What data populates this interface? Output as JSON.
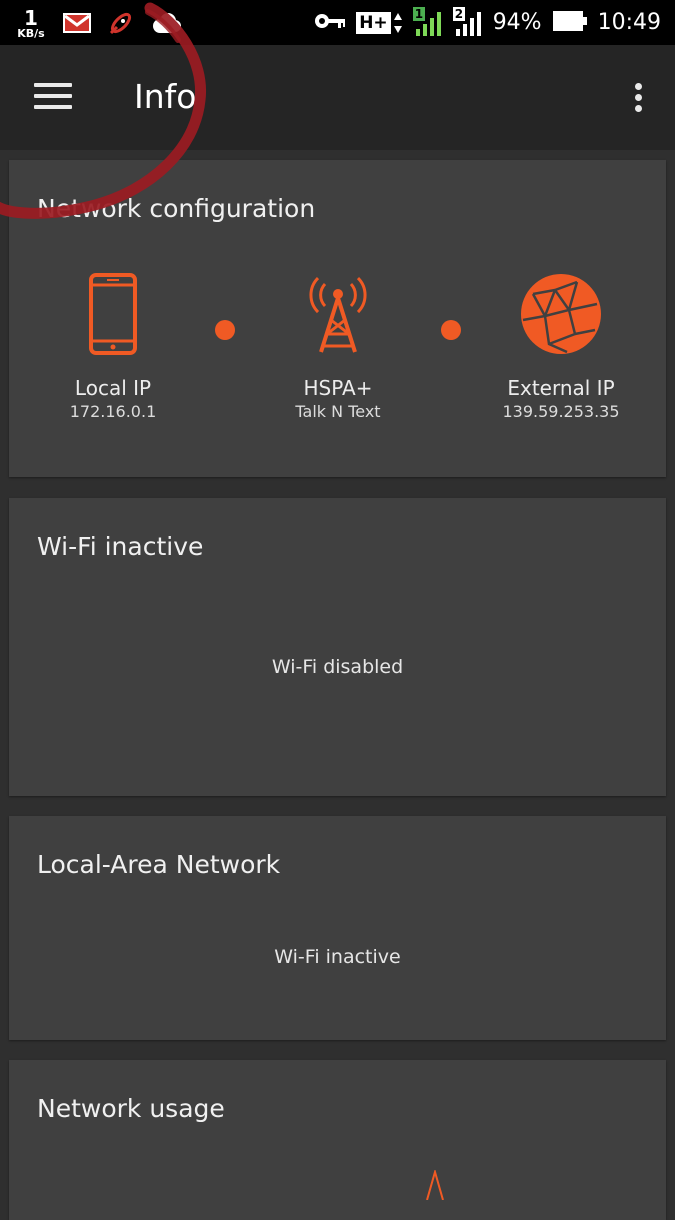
{
  "status_bar": {
    "speed_value": "1",
    "speed_unit": "KB/s",
    "network_type": "H+",
    "sim1": "1",
    "sim2": "2",
    "battery": "94%",
    "time": "10:49"
  },
  "app_bar": {
    "title": "Info"
  },
  "network_config": {
    "title": "Network configuration",
    "local": {
      "label": "Local IP",
      "value": "172.16.0.1"
    },
    "mobile": {
      "label": "HSPA+",
      "value": "Talk N Text"
    },
    "external": {
      "label": "External IP",
      "value": "139.59.253.35"
    }
  },
  "wifi": {
    "title": "Wi-Fi inactive",
    "message": "Wi-Fi disabled"
  },
  "lan": {
    "title": "Local-Area Network",
    "message": "Wi-Fi inactive"
  },
  "usage": {
    "title": "Network usage"
  },
  "colors": {
    "accent": "#f05a24",
    "card": "#404040",
    "background": "#2f2f2f",
    "app_bar": "#252525",
    "annotation": "#9b1b22"
  }
}
